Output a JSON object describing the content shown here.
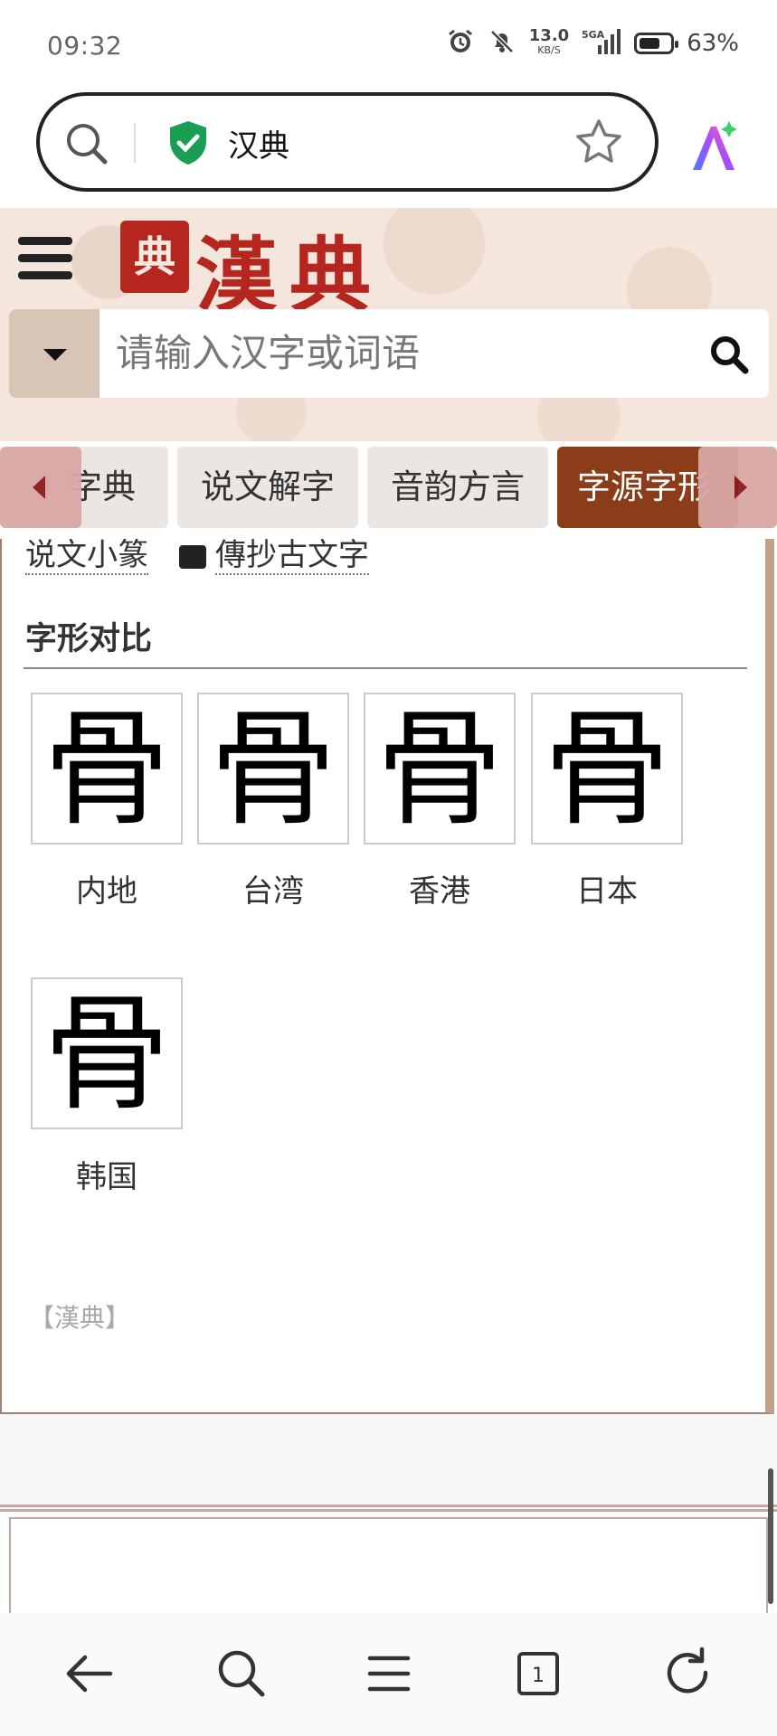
{
  "status_bar": {
    "time": "09:32",
    "speed_value": "13.0",
    "speed_unit": "KB/S",
    "network": "5GA",
    "battery": "63%"
  },
  "browser": {
    "address_text": "汉典"
  },
  "site": {
    "logo_seal": "典",
    "brand_name": "漢典",
    "search_placeholder": "请输入汉字或词语"
  },
  "tabs": [
    {
      "label": "字典",
      "active": false
    },
    {
      "label": "说文解字",
      "active": false
    },
    {
      "label": "音韵方言",
      "active": false
    },
    {
      "label": "字源字形",
      "active": true
    }
  ],
  "content": {
    "partial_link_1": "说文小篆",
    "partial_link_2": "傳抄古文字",
    "section_title": "字形对比",
    "glyph_char": "骨",
    "regions": [
      {
        "label": "内地"
      },
      {
        "label": "台湾"
      },
      {
        "label": "香港"
      },
      {
        "label": "日本"
      },
      {
        "label": "韩国"
      }
    ],
    "source_ref": "【漢典】"
  },
  "bottom_nav": {
    "tab_count": "1"
  },
  "colors": {
    "brand_red": "#b5261f",
    "tab_active": "#8b3c19",
    "hero_bg": "#f4e6dc"
  }
}
